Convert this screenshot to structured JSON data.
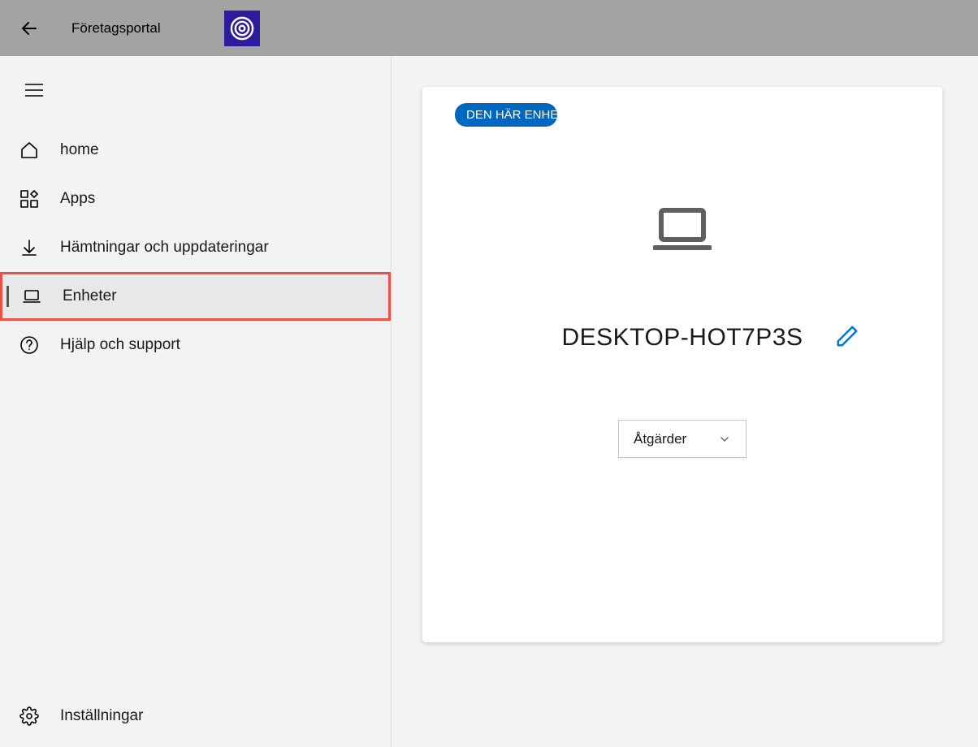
{
  "titlebar": {
    "app_name": "Företagsportal"
  },
  "sidebar": {
    "items": [
      {
        "label": "home"
      },
      {
        "label": "Apps"
      },
      {
        "label": "Hämtningar och uppdateringar"
      },
      {
        "label": "Enheter"
      },
      {
        "label": "Hjälp och support"
      }
    ],
    "settings_label": "Inställningar"
  },
  "card": {
    "badge": "DEN HÄR ENHETEN",
    "device_name": "DESKTOP-HOT7P3S",
    "actions_label": "Åtgärder"
  }
}
